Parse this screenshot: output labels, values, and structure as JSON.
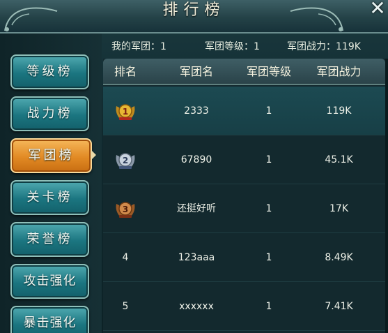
{
  "window": {
    "title": "排行榜",
    "close_icon": "close-icon"
  },
  "tabs": [
    {
      "label": "等级榜",
      "active": false
    },
    {
      "label": "战力榜",
      "active": false
    },
    {
      "label": "军团榜",
      "active": true
    },
    {
      "label": "关卡榜",
      "active": false
    },
    {
      "label": "荣誉榜",
      "active": false
    },
    {
      "label": "攻击强化",
      "active": false
    },
    {
      "label": "暴击强化",
      "active": false
    }
  ],
  "info": {
    "my_legion": "我的军团：1",
    "legion_level": "军团等级：1",
    "legion_power": "军团战力：119K"
  },
  "table": {
    "headers": [
      "排名",
      "军团名",
      "军团等级",
      "军团战力"
    ],
    "rows": [
      {
        "rank": "1",
        "medal": "gold",
        "name": "2333",
        "level": "1",
        "power": "119K"
      },
      {
        "rank": "2",
        "medal": "silver",
        "name": "67890",
        "level": "1",
        "power": "45.1K"
      },
      {
        "rank": "3",
        "medal": "bronze",
        "name": "还挺好听",
        "level": "1",
        "power": "17K"
      },
      {
        "rank": "4",
        "medal": "",
        "name": "123aaa",
        "level": "1",
        "power": "8.49K"
      },
      {
        "rank": "5",
        "medal": "",
        "name": "xxxxxx",
        "level": "1",
        "power": "7.41K"
      }
    ]
  },
  "colors": {
    "tab_active": "#e28a24",
    "tab_inactive": "#1b7580",
    "gold": "#d9a32a",
    "silver": "#b8c3d2",
    "bronze": "#c07a3b"
  }
}
